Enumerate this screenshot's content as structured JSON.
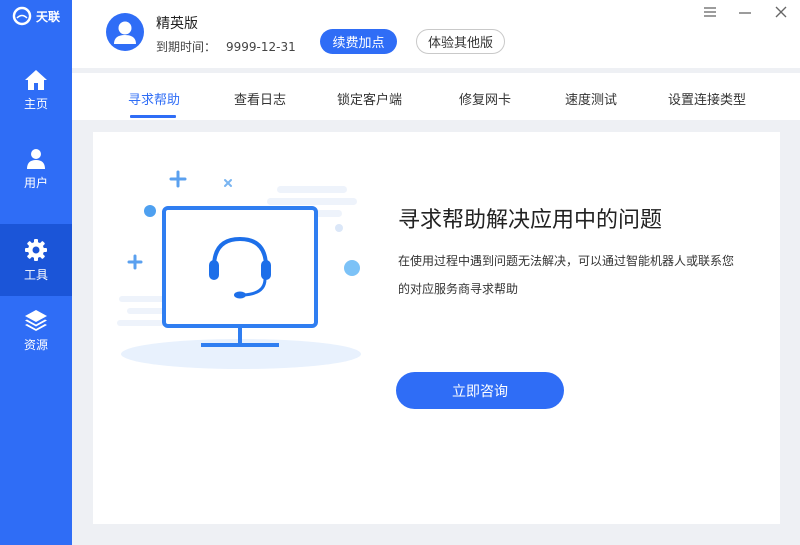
{
  "app": {
    "name": "天联",
    "logo_icon": "swirl-logo-icon"
  },
  "sidebar": {
    "items": [
      {
        "label": "主页",
        "icon": "home-icon",
        "active": false
      },
      {
        "label": "用户",
        "icon": "user-icon",
        "active": false
      },
      {
        "label": "工具",
        "icon": "gear-icon",
        "active": true
      },
      {
        "label": "资源",
        "icon": "layers-icon",
        "active": false
      }
    ]
  },
  "header": {
    "edition": "精英版",
    "expiry_label": "到期时间：",
    "expiry_value": "9999-12-31",
    "renew_button": "续费加点",
    "trial_button": "体验其他版",
    "window_controls": [
      "menu-icon",
      "minimize-icon",
      "close-icon"
    ]
  },
  "tabs": [
    {
      "label": "寻求帮助",
      "active": true
    },
    {
      "label": "查看日志",
      "active": false
    },
    {
      "label": "锁定客户端",
      "active": false
    },
    {
      "label": "修复网卡",
      "active": false
    },
    {
      "label": "速度测试",
      "active": false
    },
    {
      "label": "设置连接类型",
      "active": false
    }
  ],
  "main": {
    "headline": "寻求帮助解决应用中的问题",
    "description": "在使用过程中遇到问题无法解决，可以通过智能机器人或联系您的对应服务商寻求帮助",
    "consult_button": "立即咨询",
    "illustration_icon": "headset-monitor-icon"
  },
  "colors": {
    "primary": "#2f6df6",
    "sidebar_active": "#1b55d8",
    "background": "#eef0f4"
  }
}
